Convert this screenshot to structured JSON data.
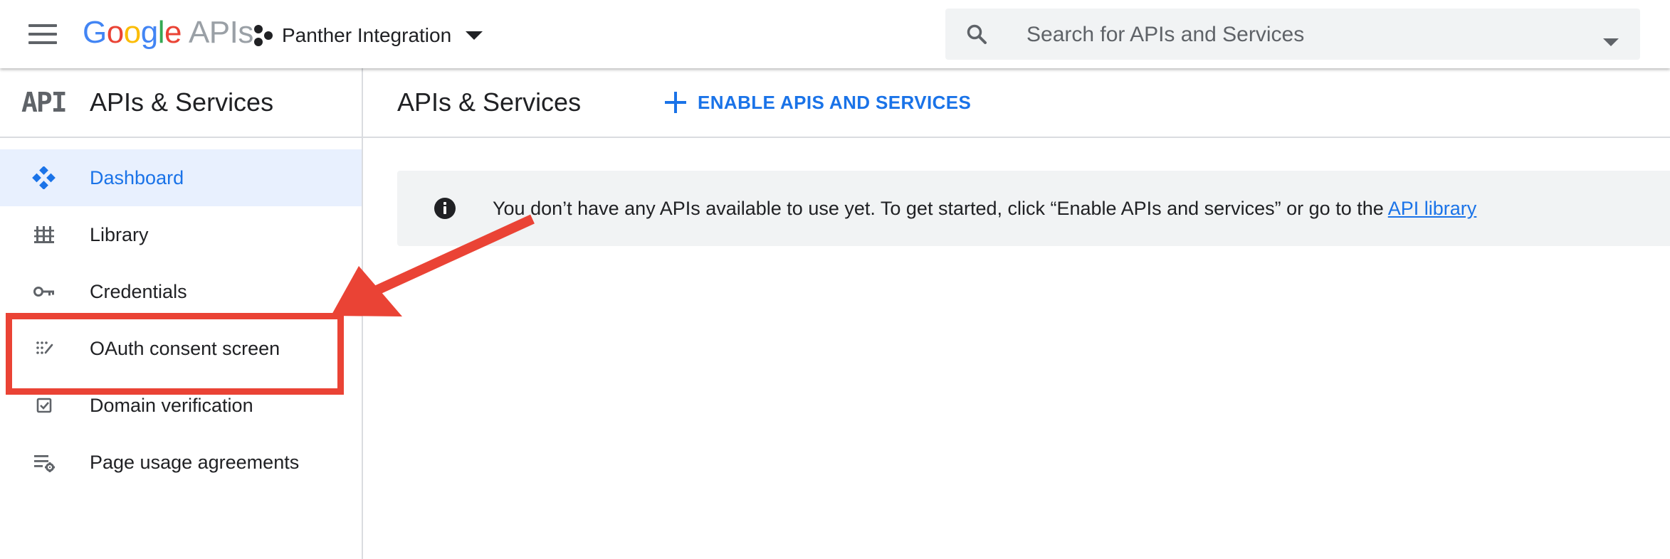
{
  "header": {
    "logo_google": [
      "G",
      "o",
      "o",
      "g",
      "l",
      "e"
    ],
    "logo_suffix": "APIs",
    "project_name": "Panther Integration",
    "search_placeholder": "Search for APIs and Services"
  },
  "sidebar": {
    "badge": "API",
    "title": "APIs & Services",
    "items": [
      {
        "label": "Dashboard",
        "icon": "dashboard-icon",
        "active": true
      },
      {
        "label": "Library",
        "icon": "library-icon"
      },
      {
        "label": "Credentials",
        "icon": "key-icon"
      },
      {
        "label": "OAuth consent screen",
        "icon": "oauth-consent-icon"
      },
      {
        "label": "Domain verification",
        "icon": "checkbox-icon"
      },
      {
        "label": "Page usage agreements",
        "icon": "settings-list-icon"
      }
    ]
  },
  "main": {
    "title": "APIs & Services",
    "enable_button": "ENABLE APIS AND SERVICES",
    "banner": {
      "text": "You don’t have any APIs available to use yet. To get started, click “Enable APIs and services” or go to the ",
      "link": "API library"
    }
  },
  "colors": {
    "accent": "#1a73e8",
    "active_bg": "#e8f0fe",
    "annotation": "#ea4335",
    "banner_bg": "#f1f3f4"
  }
}
